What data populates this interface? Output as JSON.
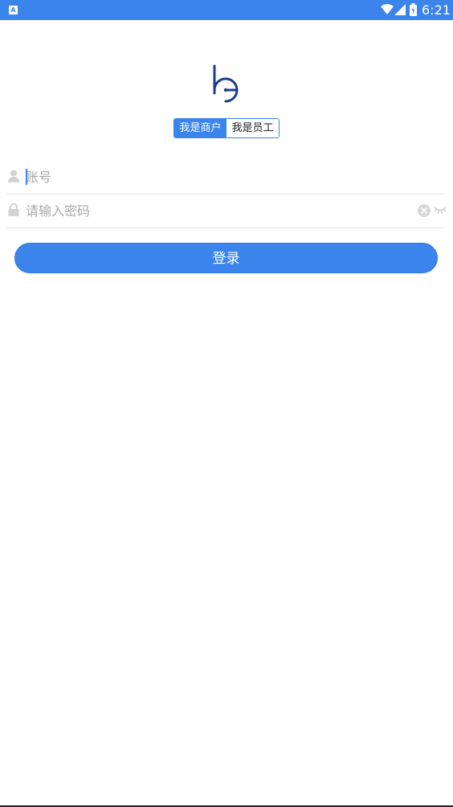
{
  "status_bar": {
    "app_icon_letter": "A",
    "time": "6:21",
    "icons": [
      "app-notification-icon",
      "wifi-icon",
      "cell-signal-icon",
      "battery-charging-icon"
    ]
  },
  "logo": {
    "icon": "brand-logo-icon",
    "color": "#1c3c8c"
  },
  "role_toggle": {
    "merchant_label": "我是商户",
    "staff_label": "我是员工",
    "selected": "merchant"
  },
  "account_field": {
    "icon": "user-icon",
    "placeholder": "账号",
    "value": ""
  },
  "password_field": {
    "icon": "lock-icon",
    "placeholder": "请输入密码",
    "value": "",
    "clear_icon": "clear-icon",
    "visibility_icon": "eye-closed-icon"
  },
  "login_button": {
    "label": "登录"
  },
  "colors": {
    "accent": "#3a84ec",
    "placeholder": "#a8a8a8",
    "divider": "#e2e2e2"
  }
}
